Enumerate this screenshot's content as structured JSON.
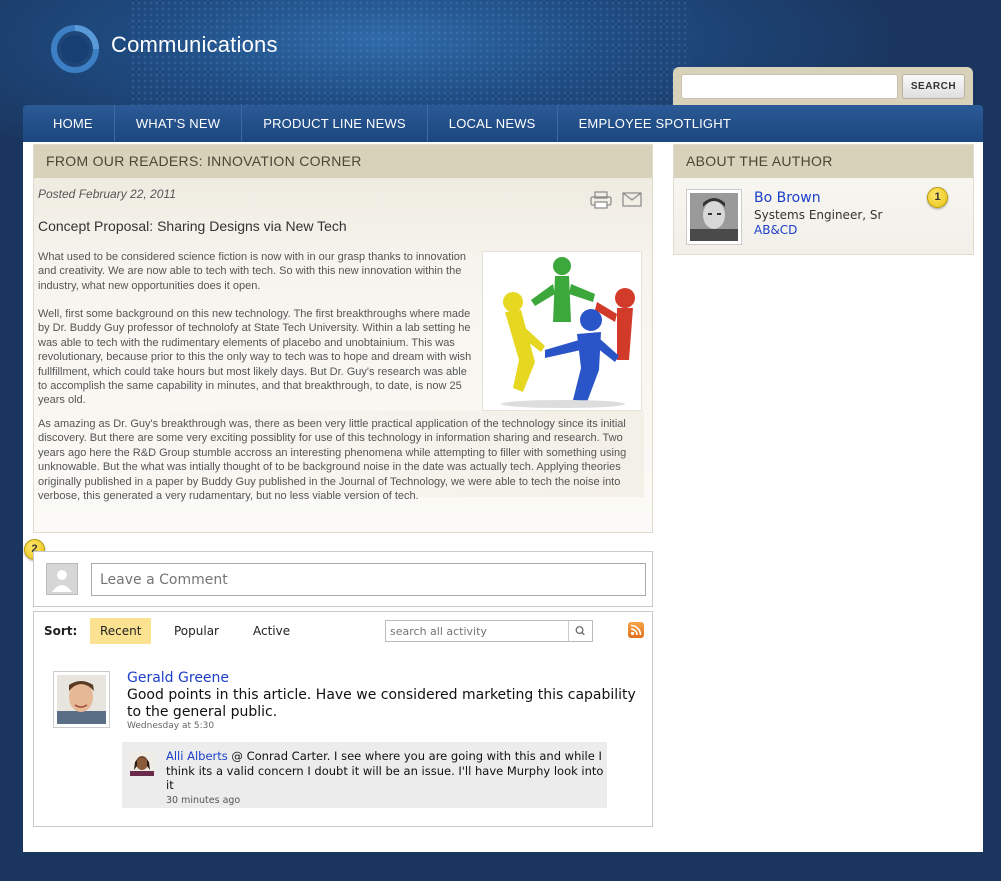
{
  "header": {
    "brand": "Communications",
    "search": {
      "placeholder": "",
      "button_label": "SEARCH"
    }
  },
  "nav": {
    "items": [
      {
        "label": "HOME"
      },
      {
        "label": "WHAT'S NEW"
      },
      {
        "label": "PRODUCT LINE NEWS"
      },
      {
        "label": "LOCAL NEWS"
      },
      {
        "label": "EMPLOYEE SPOTLIGHT"
      }
    ],
    "active": "WHAT'S NEW"
  },
  "article": {
    "section_title": "FROM OUR READERS: INNOVATION CORNER",
    "posted": "Posted February 22, 2011",
    "title": "Concept Proposal: Sharing Designs via New Tech",
    "paragraphs": [
      "What used to be considered science fiction is now with in our grasp thanks to innovation and creativity. We are now able to tech with tech. So with this new innovation within the industry, what new opportunities does it open.",
      "Well, first some background on this new technology.  The first breakthroughs where made by Dr. Buddy Guy professor of technolofy at State Tech University.  Within a lab setting he was able to tech with the rudimentary elements of placebo and unobtainium.  This was revolutionary, because prior to this the only way to tech was to hope and dream with wish fullfillment, which could take hours but most likely days.  But Dr. Guy's research was able to accomplish the same capability in minutes, and that breakthrough, to date, is now 25 years old.",
      "As amazing as Dr. Guy's breakthrough was, there as been very little practical application of the technology since its initial discovery. But there are some very exciting possiblity for use of this technology in information sharing and research. Two years ago here the R&D Group stumble accross an interesting phenomena while attempting to filler with something using unknowable.  But the what was intially thought of to be background noise in the date was actually tech.  Applying theories originally published in a paper by Buddy Guy published in the Journal of Technology, we were able to tech the noise into verbose, this generated  a very rudamentary, but no less viable version of tech."
    ]
  },
  "author": {
    "section_title": "ABOUT THE AUTHOR",
    "name": "Bo Brown",
    "role": "Systems Engineer, Sr",
    "org": "AB&CD"
  },
  "markers": [
    "1",
    "2"
  ],
  "comment": {
    "placeholder": "Leave a Comment"
  },
  "activity": {
    "sort_label": "Sort:",
    "tabs": [
      "Recent",
      "Popular",
      "Active"
    ],
    "active_tab": "Recent",
    "search_placeholder": "search all activity",
    "comments": [
      {
        "author": "Gerald Greene",
        "text": "Good points in this article. Have we considered marketing this capability to the general public.",
        "time": "Wednesday at 5:30",
        "replies": [
          {
            "author": "Alli Alberts",
            "text": " @ Conrad Carter.  I see where you are going with this and while I think its a valid concern I doubt it will be an issue.  I'll have Murphy look into it",
            "time": "30 minutes ago"
          }
        ]
      }
    ]
  },
  "colors": {
    "page_bg": "#1a365f",
    "nav_bg": "#1c467e",
    "section_header": "#d9d2bb",
    "link": "#1c3fc9",
    "active_tab": "#fbe291",
    "marker": "#e8c214"
  }
}
